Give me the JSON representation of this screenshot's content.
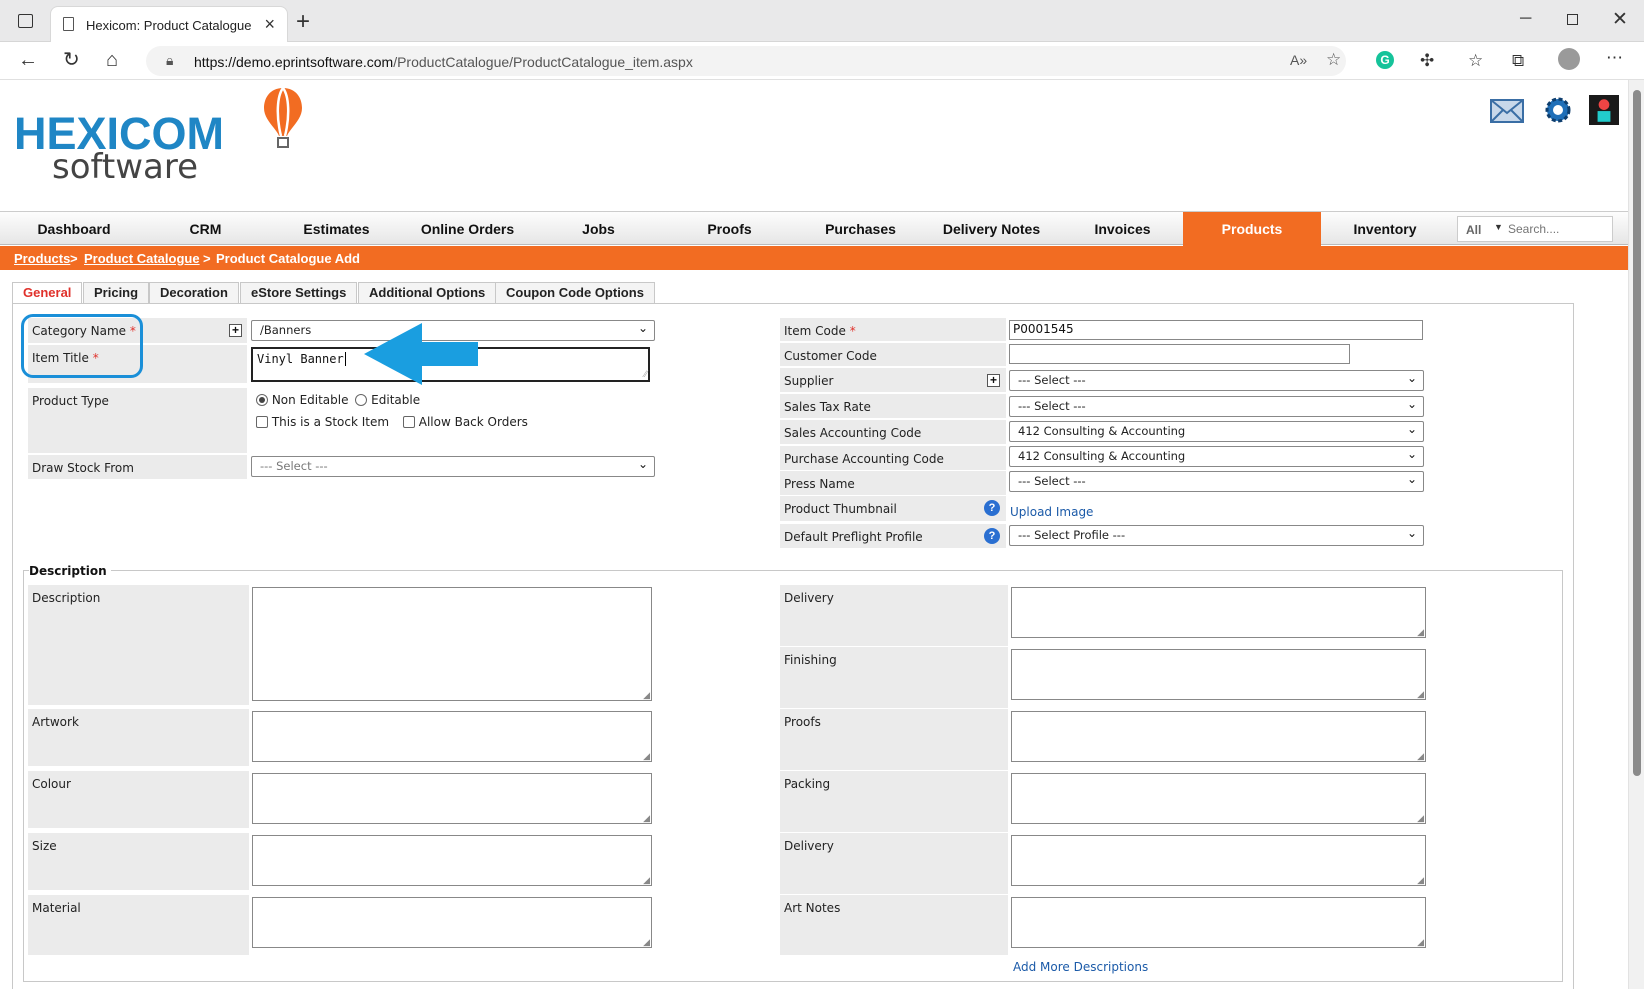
{
  "browser": {
    "tab_title": "Hexicom: Product Catalogue",
    "url_host": "https://demo.eprintsoftware.com",
    "url_path": "/ProductCatalogue/ProductCatalogue_item.aspx"
  },
  "logo": {
    "line1": "HEXICOM",
    "line2": "software"
  },
  "nav": {
    "items": [
      "Dashboard",
      "CRM",
      "Estimates",
      "Online Orders",
      "Jobs",
      "Proofs",
      "Purchases",
      "Delivery Notes",
      "Invoices",
      "Products",
      "Inventory"
    ],
    "active": "Products",
    "search_scope": "All",
    "search_placeholder": "Search...."
  },
  "breadcrumb": {
    "root": "Products",
    "sep1": ">",
    "parent": "Product Catalogue",
    "sep2": ">",
    "current": "Product Catalogue Add"
  },
  "subtabs": [
    "General",
    "Pricing",
    "Decoration",
    "eStore Settings",
    "Additional Options",
    "Coupon Code Options"
  ],
  "left_form": {
    "category_label": "Category Name",
    "category_value": "/Banners",
    "item_title_label": "Item Title",
    "item_title_value": "Vinyl Banner",
    "product_type_label": "Product Type",
    "non_editable": "Non Editable",
    "editable": "Editable",
    "stock_item": "This is a Stock Item",
    "back_orders": "Allow Back Orders",
    "draw_stock_label": "Draw Stock From",
    "draw_stock_value": "--- Select ---",
    "required_mark": "*"
  },
  "right_form": {
    "item_code_label": "Item Code",
    "item_code_value": "P0001545",
    "customer_code_label": "Customer Code",
    "customer_code_value": "",
    "supplier_label": "Supplier",
    "supplier_value": "--- Select ---",
    "sales_tax_label": "Sales Tax Rate",
    "sales_tax_value": "--- Select ---",
    "sales_acct_label": "Sales Accounting Code",
    "sales_acct_value": "412 Consulting & Accounting",
    "purchase_acct_label": "Purchase Accounting Code",
    "purchase_acct_value": "412 Consulting & Accounting",
    "press_label": "Press Name",
    "press_value": "--- Select ---",
    "thumb_label": "Product Thumbnail",
    "thumb_link": "Upload Image",
    "preflight_label": "Default Preflight Profile",
    "preflight_value": "--- Select Profile ---"
  },
  "description": {
    "legend": "Description",
    "left_fields": [
      "Description",
      "Artwork",
      "Colour",
      "Size",
      "Material"
    ],
    "right_fields": [
      "Delivery",
      "Finishing",
      "Proofs",
      "Packing",
      "Delivery",
      "Art Notes"
    ],
    "add_more": "Add More Descriptions"
  },
  "colors": {
    "accent": "#f26c22",
    "brand_blue": "#1f86c5",
    "highlight": "#1a8fd8"
  }
}
